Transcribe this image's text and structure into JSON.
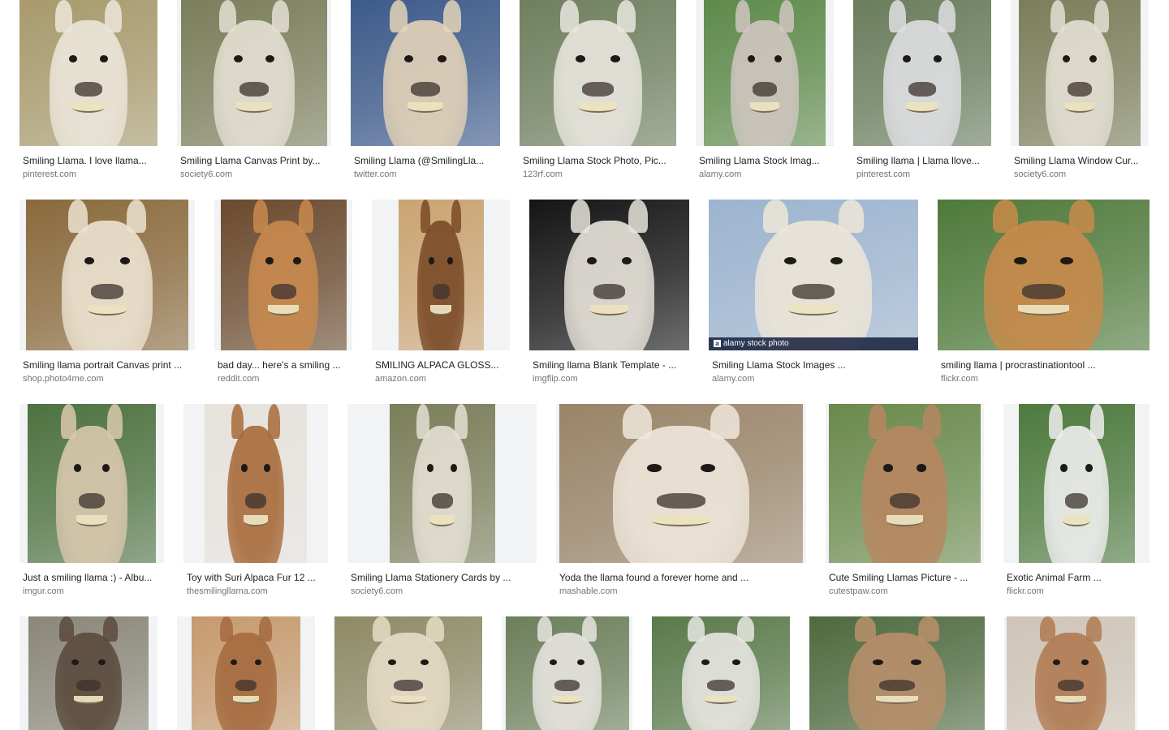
{
  "rows": [
    [
      {
        "title": "Smiling Llama. I love llama...",
        "source": "pinterest.com",
        "bg": "#a89a6c",
        "fur": "#ece6da",
        "w": 170,
        "pw": 170
      },
      {
        "title": "Smiling Llama Canvas Print by...",
        "source": "society6.com",
        "bg": "#7b7e5a",
        "fur": "#e4dfd3",
        "w": 190,
        "pw": 180
      },
      {
        "title": "Smiling Llama (@SmilingLla...",
        "source": "twitter.com",
        "bg": "#3d5a8a",
        "fur": "#e3d3b8",
        "w": 184,
        "pw": 184
      },
      {
        "title": "Smiling Llama Stock Photo, Pic...",
        "source": "123rf.com",
        "bg": "#6f7f5e",
        "fur": "#e8e6df",
        "w": 193,
        "pw": 193
      },
      {
        "title": "Smiling Llama Stock Imag...",
        "source": "alamy.com",
        "bg": "#5e8a4a",
        "fur": "#cfc6c0",
        "w": 170,
        "pw": 150
      },
      {
        "title": "Smiling llama | Llama llove...",
        "source": "pinterest.com",
        "bg": "#6a7d5c",
        "fur": "#dedfe2",
        "w": 170,
        "pw": 170
      },
      {
        "title": "Smiling Llama Window Cur...",
        "source": "society6.com",
        "bg": "#7b7e5a",
        "fur": "#e4dfd3",
        "w": 170,
        "pw": 150
      }
    ],
    [
      {
        "title": "Smiling llama portrait Canvas print ...",
        "source": "shop.photo4me.com",
        "bg": "#8a6a3c",
        "fur": "#ece3d1",
        "w": 216,
        "pw": 200
      },
      {
        "title": "bad day... here's a smiling ...",
        "source": "reddit.com",
        "bg": "#6b4a2e",
        "fur": "#c98a4e",
        "w": 170,
        "pw": 155
      },
      {
        "title": "SMILING ALPACA GLOSS...",
        "source": "amazon.com",
        "bg": "#caa472",
        "fur": "#7a4a26",
        "w": 170,
        "pw": 105
      },
      {
        "title": "Smiling llama Blank Template - ...",
        "source": "imgflip.com",
        "bg": "#151515",
        "fur": "#e8e4dc",
        "w": 197,
        "pw": 197
      },
      {
        "title": "Smiling Llama Stock Images ...",
        "source": "alamy.com",
        "bg": "#9cb4cf",
        "fur": "#ede6d8",
        "w": 258,
        "pw": 258,
        "stock": "alamy stock photo"
      },
      {
        "title": "smiling llama | procrastinationtool ...",
        "source": "flickr.com",
        "bg": "#4f7a3a",
        "fur": "#c98a4a",
        "w": 261,
        "pw": 261
      }
    ],
    [
      {
        "title": "Just a smiling llama :) - Albu...",
        "source": "imgur.com",
        "bg": "#4d7240",
        "fur": "#d9c8ae",
        "w": 178,
        "pw": 158
      },
      {
        "title": "Toy with Suri Alpaca Fur 12 ...",
        "source": "thesmilingllama.com",
        "bg": "#e6e2dc",
        "fur": "#a86a3a",
        "w": 178,
        "pw": 126
      },
      {
        "title": "Smiling Llama Stationery Cards by ...",
        "source": "society6.com",
        "bg": "#7b7e5a",
        "fur": "#e4dfd3",
        "w": 233,
        "pw": 130
      },
      {
        "title": "Yoda the llama found a forever home and ...",
        "source": "mashable.com",
        "bg": "#9a8468",
        "fur": "#efe7dc",
        "w": 308,
        "pw": 300
      },
      {
        "title": "Cute Smiling Llamas Picture - ...",
        "source": "cutestpaw.com",
        "bg": "#6a8a4c",
        "fur": "#b78660",
        "w": 195,
        "pw": 187
      },
      {
        "title": "Exotic Animal Farm ...",
        "source": "flickr.com",
        "bg": "#4e7a3e",
        "fur": "#eeeeee",
        "w": 180,
        "pw": 143
      }
    ],
    [
      {
        "title": "",
        "source": "",
        "bg": "#8a8678",
        "fur": "#5a4a3c",
        "w": 170,
        "pw": 148
      },
      {
        "title": "",
        "source": "",
        "bg": "#c69a6e",
        "fur": "#a56a3e",
        "w": 170,
        "pw": 134
      },
      {
        "title": "",
        "source": "",
        "bg": "#8e8a66",
        "fur": "#e6dcc6",
        "w": 182,
        "pw": 182
      },
      {
        "title": "",
        "source": "",
        "bg": "#6c7f5a",
        "fur": "#e6e4df",
        "w": 161,
        "pw": 152
      },
      {
        "title": "",
        "source": "",
        "bg": "#5a7a4a",
        "fur": "#e8e6e2",
        "w": 170,
        "pw": 170
      },
      {
        "title": "",
        "source": "",
        "bg": "#4e6a3e",
        "fur": "#b88f6a",
        "w": 216,
        "pw": 216
      },
      {
        "title": "",
        "source": "",
        "bg": "#cfc4b6",
        "fur": "#b07a52",
        "w": 164,
        "pw": 158
      }
    ]
  ]
}
